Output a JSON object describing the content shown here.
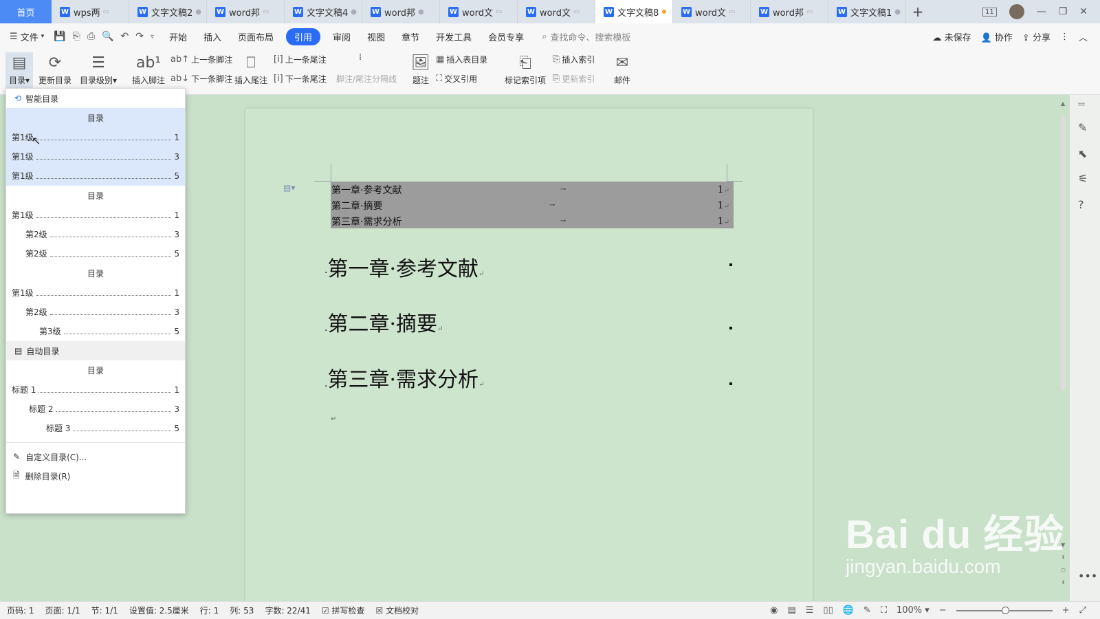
{
  "tabbar": {
    "home": "首页",
    "tabs": [
      {
        "label": "wps两",
        "mark": "▭"
      },
      {
        "label": "文字文稿2",
        "mark": "●"
      },
      {
        "label": "word邦",
        "mark": "▭"
      },
      {
        "label": "文字文稿4",
        "mark": "●"
      },
      {
        "label": "word邦",
        "mark": "●"
      },
      {
        "label": "word文",
        "mark": "▭"
      },
      {
        "label": "word文",
        "mark": "▭"
      },
      {
        "label": "文字文稿8",
        "mark": ""
      },
      {
        "label": "word文",
        "mark": "▭"
      },
      {
        "label": "word邦",
        "mark": "▭"
      },
      {
        "label": "文字文稿1",
        "mark": "●"
      }
    ],
    "add": "+",
    "window_badge": "11",
    "minimize": "—",
    "restore": "❐",
    "close": "✕"
  },
  "menubar": {
    "file": "文件",
    "tabs": [
      "开始",
      "插入",
      "页面布局",
      "引用",
      "审阅",
      "视图",
      "章节",
      "开发工具",
      "会员专享"
    ],
    "active_tab": "引用",
    "search": "查找命令、搜索模板",
    "unsaved": "未保存",
    "collab": "协作",
    "share": "分享"
  },
  "ribbon": {
    "toc": "目录",
    "update_toc": "更新目录",
    "toc_level": "目录级别",
    "insert_footnote": "插入脚注",
    "prev_footnote": "上一条脚注",
    "next_footnote": "下一条脚注",
    "insert_endnote": "插入尾注",
    "prev_endnote": "上一条尾注",
    "next_endnote": "下一条尾注",
    "note_separator": "脚注/尾注分隔线",
    "caption": "题注",
    "insert_table_toc": "插入表目录",
    "cross_ref": "交叉引用",
    "mark_index": "标记索引项",
    "insert_index": "插入索引",
    "update_index": "更新索引",
    "mail": "邮件"
  },
  "dropdown": {
    "smart_toc": "智能目录",
    "auto_toc": "自动目录",
    "custom_toc": "自定义目录(C)...",
    "delete_toc": "删除目录(R)",
    "previews": [
      {
        "title": "目录",
        "lines": [
          {
            "label": "第1级",
            "page": "1",
            "indent": 0
          },
          {
            "label": "第1级",
            "page": "3",
            "indent": 0
          },
          {
            "label": "第1级",
            "page": "5",
            "indent": 0
          }
        ]
      },
      {
        "title": "目录",
        "lines": [
          {
            "label": "第1级",
            "page": "1",
            "indent": 0
          },
          {
            "label": "第2级",
            "page": "3",
            "indent": 1
          },
          {
            "label": "第2级",
            "page": "5",
            "indent": 1
          }
        ]
      },
      {
        "title": "目录",
        "lines": [
          {
            "label": "第1级",
            "page": "1",
            "indent": 0
          },
          {
            "label": "第2级",
            "page": "3",
            "indent": 1
          },
          {
            "label": "第3级",
            "page": "5",
            "indent": 2
          }
        ]
      }
    ],
    "auto_preview": {
      "title": "目录",
      "lines": [
        {
          "label": "标题 1",
          "page": "1",
          "indent": 0
        },
        {
          "label": "标题 2",
          "page": "3",
          "indent": 1
        },
        {
          "label": "标题 3",
          "page": "5",
          "indent": 2
        }
      ]
    }
  },
  "document": {
    "toc_field": [
      {
        "text": "第一章·参考文献",
        "page": "1"
      },
      {
        "text": "第二章·摘要",
        "page": "1"
      },
      {
        "text": "第三章·需求分析",
        "page": "1"
      }
    ],
    "headings": [
      "第一章·参考文献",
      "第二章·摘要",
      "第三章·需求分析"
    ]
  },
  "statusbar": {
    "page_no": "页码: 1",
    "pages": "页面: 1/1",
    "section": "节: 1/1",
    "setting": "设置值: 2.5厘米",
    "row": "行: 1",
    "col": "列: 53",
    "words": "字数: 22/41",
    "spell": "拼写检查",
    "proof": "文档校对",
    "zoom": "100%"
  },
  "watermark": {
    "logo": "Bai du 经验",
    "url": "jingyan.baidu.com"
  },
  "colors": {
    "accent": "#2a6df4",
    "page_bg": "#cde5cd",
    "field_hl": "#9c9c9c",
    "menu_hl": "#dbe8fb"
  }
}
